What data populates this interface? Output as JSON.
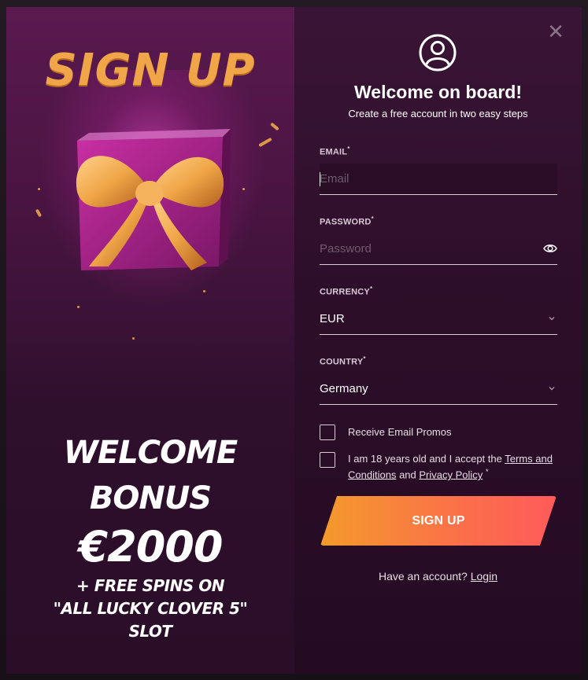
{
  "promo": {
    "title": "SIGN UP",
    "bonus_line1": "WELCOME",
    "bonus_line2": "BONUS",
    "bonus_amount": "€2000",
    "bonus_sub1": "+ FREE SPINS ON",
    "bonus_sub2": "\"ALL LUCKY CLOVER 5\"",
    "bonus_sub3": "SLOT",
    "gift_icon": "gift-box-icon"
  },
  "form": {
    "close_icon": "close-icon",
    "user_icon": "user-circle-icon",
    "welcome": "Welcome on board!",
    "subtitle": "Create a free account in two easy steps",
    "email": {
      "label": "EMAIL",
      "required": "*",
      "placeholder": "Email",
      "value": ""
    },
    "password": {
      "label": "PASSWORD",
      "required": "*",
      "placeholder": "Password",
      "value": "",
      "toggle_icon": "eye-icon"
    },
    "currency": {
      "label": "CURRENCY",
      "required": "*",
      "value": "EUR",
      "icon": "chevron-down-icon"
    },
    "country": {
      "label": "COUNTRY",
      "required": "*",
      "value": "Germany",
      "icon": "chevron-down-icon"
    },
    "promos_checkbox": {
      "label": "Receive Email Promos",
      "checked": false
    },
    "terms_checkbox": {
      "text_before": "I am 18 years old and I accept the",
      "terms_link": "Terms and Conditions",
      "and": "and",
      "privacy_link": "Privacy Policy",
      "required": "*",
      "checked": false
    },
    "signup_button": "SIGN UP",
    "have_account": "Have an account?",
    "login_link": "Login"
  },
  "colors": {
    "accent_gold": "#f0a648",
    "button_start": "#f49a2c",
    "button_end": "#ff5a5a",
    "panel_bg": "#2c0e29"
  }
}
